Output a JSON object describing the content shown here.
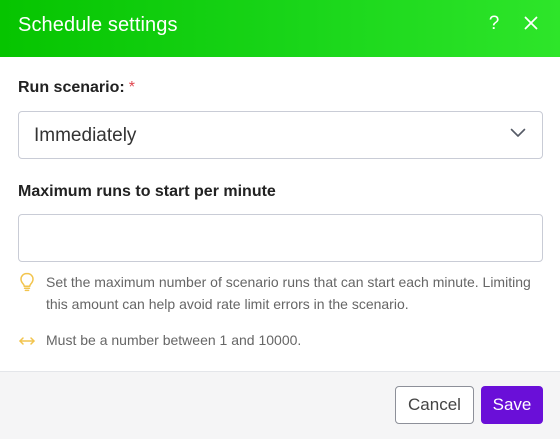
{
  "dialog": {
    "title": "Schedule settings",
    "help_glyph": "?",
    "close_glyph": "×",
    "header_gradient": [
      "#06c400",
      "#2ee52a"
    ]
  },
  "run_scenario": {
    "label": "Run scenario:",
    "required_mark": "*",
    "selected_value": "Immediately",
    "icon": "chevron-down-icon"
  },
  "max_runs": {
    "label": "Maximum runs to start per minute",
    "value": "",
    "placeholder": ""
  },
  "hints": {
    "info": {
      "icon": "lightbulb-icon",
      "text": "Set the maximum number of scenario runs that can start each minute. Limiting this amount can help avoid rate limit errors in the scenario."
    },
    "range": {
      "icon": "range-arrows-icon",
      "text": "Must be a number between 1 and 10000."
    }
  },
  "footer": {
    "cancel_label": "Cancel",
    "save_label": "Save"
  },
  "colors": {
    "accent": "#6a0fd8",
    "required": "#e0464f",
    "hint_icon": "#f2c44d"
  }
}
